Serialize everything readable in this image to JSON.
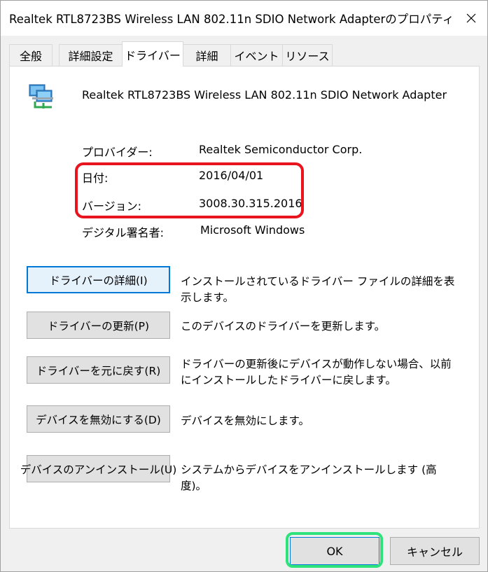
{
  "window": {
    "title": "Realtek RTL8723BS Wireless LAN 802.11n SDIO Network Adapterのプロパティ"
  },
  "tabs": [
    {
      "label": "全般"
    },
    {
      "label": "詳細設定"
    },
    {
      "label": "ドライバー"
    },
    {
      "label": "詳細"
    },
    {
      "label": "イベント"
    },
    {
      "label": "リソース"
    }
  ],
  "device": {
    "name": "Realtek RTL8723BS Wireless LAN 802.11n SDIO Network Adapter",
    "icon": "network-adapter-icon"
  },
  "info": {
    "provider_label": "プロバイダー:",
    "provider_value": "Realtek Semiconductor Corp.",
    "date_label": "日付:",
    "date_value": "2016/04/01",
    "version_label": "バージョン:",
    "version_value": "3008.30.315.2016",
    "signer_label": "デジタル署名者:",
    "signer_value": "Microsoft Windows"
  },
  "actions": [
    {
      "button": "ドライバーの詳細(I)",
      "description": "インストールされているドライバー ファイルの詳細を表示します。"
    },
    {
      "button": "ドライバーの更新(P)",
      "description": "このデバイスのドライバーを更新します。"
    },
    {
      "button": "ドライバーを元に戻す(R)",
      "description": "ドライバーの更新後にデバイスが動作しない場合、以前にインストールしたドライバーに戻します。"
    },
    {
      "button": "デバイスを無効にする(D)",
      "description": "デバイスを無効にします。"
    },
    {
      "button": "デバイスのアンインストール(U)",
      "description": "システムからデバイスをアンインストールします (高度)。"
    }
  ],
  "footer": {
    "ok_label": "OK",
    "cancel_label": "キャンセル"
  },
  "colors": {
    "highlight_red": "#e8141e",
    "highlight_green": "#2ee37c",
    "focus_blue": "#0078d7"
  }
}
